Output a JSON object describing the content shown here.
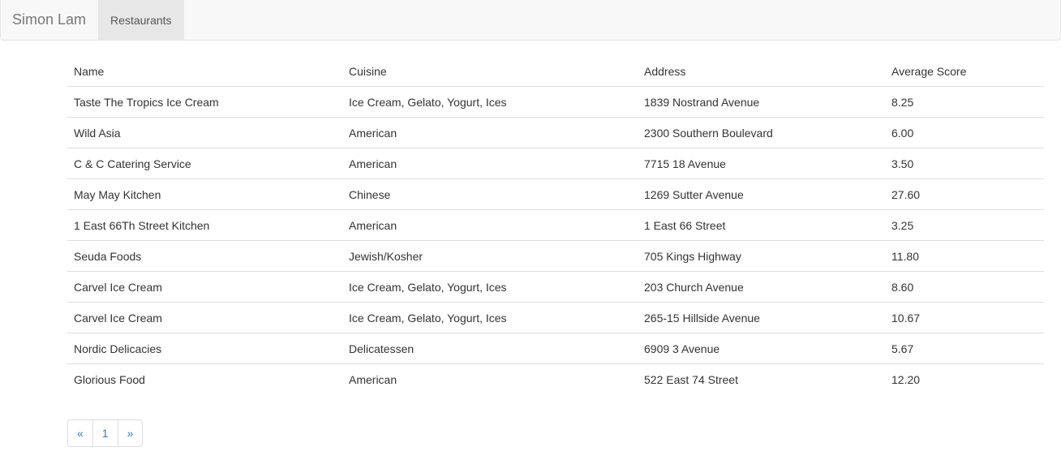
{
  "navbar": {
    "brand": "Simon Lam",
    "items": [
      {
        "label": "Restaurants",
        "active": true
      }
    ]
  },
  "table": {
    "headers": [
      "Name",
      "Cuisine",
      "Address",
      "Average Score"
    ],
    "rows": [
      [
        "Taste The Tropics Ice Cream",
        "Ice Cream, Gelato, Yogurt, Ices",
        "1839 Nostrand Avenue",
        "8.25"
      ],
      [
        "Wild Asia",
        "American",
        "2300 Southern Boulevard",
        "6.00"
      ],
      [
        "C & C Catering Service",
        "American",
        "7715 18 Avenue",
        "3.50"
      ],
      [
        "May May Kitchen",
        "Chinese",
        "1269 Sutter Avenue",
        "27.60"
      ],
      [
        "1 East 66Th Street Kitchen",
        "American",
        "1 East 66 Street",
        "3.25"
      ],
      [
        "Seuda Foods",
        "Jewish/Kosher",
        "705 Kings Highway",
        "11.80"
      ],
      [
        "Carvel Ice Cream",
        "Ice Cream, Gelato, Yogurt, Ices",
        "203 Church Avenue",
        "8.60"
      ],
      [
        "Carvel Ice Cream",
        "Ice Cream, Gelato, Yogurt, Ices",
        "265-15 Hillside Avenue",
        "10.67"
      ],
      [
        "Nordic Delicacies",
        "Delicatessen",
        "6909 3 Avenue",
        "5.67"
      ],
      [
        "Glorious Food",
        "American",
        "522 East 74 Street",
        "12.20"
      ]
    ]
  },
  "pagination": {
    "prev": "«",
    "pages": [
      "1"
    ],
    "next": "»"
  },
  "colors": {
    "navbar_bg": "#f8f8f8",
    "active_tab_bg": "#e7e7e7",
    "link": "#337ab7",
    "border": "#dddddd"
  }
}
